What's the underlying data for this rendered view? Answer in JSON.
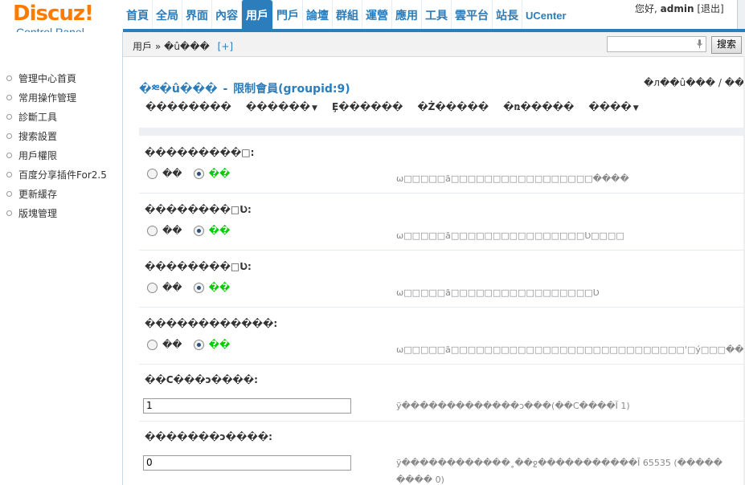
{
  "header": {
    "logo_brand": "Discuz",
    "logo_mark": "!",
    "logo_sub": "Control Panel",
    "nav": [
      "首頁",
      "全局",
      "界面",
      "內容",
      "用戶",
      "門戶",
      "論壇",
      "群組",
      "運營",
      "應用",
      "工具",
      "雲平台",
      "站長",
      "UCenter"
    ],
    "active_nav": "用戶",
    "greeting": "您好,",
    "username": "admin",
    "logout": "[退出]"
  },
  "subbar": {
    "crumb_root": "用戶",
    "crumb_sep": "»",
    "crumb_current": "�û���",
    "crumb_add": "[+]",
    "search_placeholder": "",
    "search_button": "搜索"
  },
  "sidebar": {
    "items": [
      "管理中心首頁",
      "常用操作管理",
      "診斷工具",
      "搜索設置",
      "用戶權限",
      "百度分享插件For2.5",
      "更新緩存",
      "版塊管理"
    ]
  },
  "main": {
    "title_part1": "�༭�û���",
    "title_sep": "-",
    "title_part2": "限制會員(groupid:9)",
    "title_right": "�л��û��� / ���",
    "tabs": [
      {
        "label": "��������",
        "arrow": ""
      },
      {
        "label": "������",
        "arrow": "▼"
      },
      {
        "label": "Ȩ������",
        "arrow": ""
      },
      {
        "label": "�Ż�����",
        "arrow": ""
      },
      {
        "label": "�ռ�����",
        "arrow": ""
      },
      {
        "label": "����",
        "arrow": "▼"
      }
    ],
    "rows": [
      {
        "label": "���������□:",
        "opt_no": "��",
        "opt_yes": "��",
        "desc": "ѡ□□□□□ã□□□□□□□□□□□□□□□□□����"
      },
      {
        "label": "��������□Ʋ:",
        "opt_no": "��",
        "opt_yes": "��",
        "desc": "ѡ□□□□□ã□□□□□□□□□□□□□□□□Ʋ□□□□"
      },
      {
        "label": "��������□Ʋ:",
        "opt_no": "��",
        "opt_yes": "��",
        "desc": "ѡ□□□□□ã□□□□□□□□□□□□□□□□□Ʋ"
      },
      {
        "label": "������������:",
        "opt_no": "��",
        "opt_yes": "��",
        "desc": "ѡ□□□□□ã□□□□□□□□□□□□□□□□□□□□□□□□□□□□'□ý□□□���"
      }
    ],
    "field1": {
      "label": "��С���ɔ����:",
      "value": "1",
      "desc": "ÿ�������������ɔ���(��С����Ĭ 1)"
    },
    "field2": {
      "label": "�������ɔ����:",
      "value": "0",
      "desc": "ÿ������������˳��ջ�����������Ĭ 65535 (�����",
      "desc2": "���� 0)"
    }
  }
}
